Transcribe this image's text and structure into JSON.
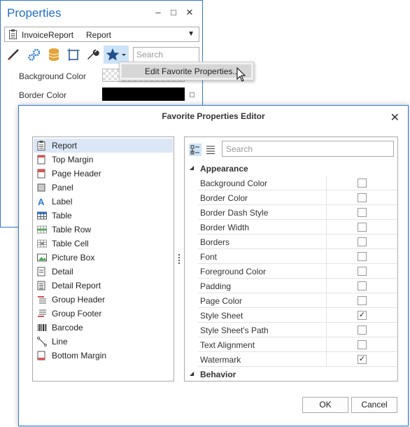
{
  "properties_panel": {
    "title": "Properties",
    "selector": {
      "name": "InvoiceReport",
      "type": "Report"
    },
    "search_placeholder": "Search",
    "rows": [
      {
        "label": "Background Color"
      },
      {
        "label": "Border Color"
      }
    ],
    "context_menu": {
      "item": "Edit Favorite Properties..."
    }
  },
  "dialog": {
    "title": "Favorite Properties Editor",
    "left_list": [
      {
        "label": "Report",
        "icon": "report-icon",
        "selected": true
      },
      {
        "label": "Top Margin",
        "icon": "top-margin-icon"
      },
      {
        "label": "Page Header",
        "icon": "page-header-icon"
      },
      {
        "label": "Panel",
        "icon": "panel-icon"
      },
      {
        "label": "Label",
        "icon": "label-icon"
      },
      {
        "label": "Table",
        "icon": "table-icon"
      },
      {
        "label": "Table Row",
        "icon": "table-row-icon"
      },
      {
        "label": "Table Cell",
        "icon": "table-cell-icon"
      },
      {
        "label": "Picture Box",
        "icon": "picture-box-icon"
      },
      {
        "label": "Detail",
        "icon": "detail-icon"
      },
      {
        "label": "Detail Report",
        "icon": "detail-report-icon"
      },
      {
        "label": "Group Header",
        "icon": "group-header-icon"
      },
      {
        "label": "Group Footer",
        "icon": "group-footer-icon"
      },
      {
        "label": "Barcode",
        "icon": "barcode-icon"
      },
      {
        "label": "Line",
        "icon": "line-icon"
      },
      {
        "label": "Bottom Margin",
        "icon": "bottom-margin-icon"
      }
    ],
    "search_placeholder": "Search",
    "categories": [
      {
        "name": "Appearance",
        "properties": [
          {
            "name": "Background Color",
            "checked": false
          },
          {
            "name": "Border Color",
            "checked": false
          },
          {
            "name": "Border Dash Style",
            "checked": false
          },
          {
            "name": "Border Width",
            "checked": false
          },
          {
            "name": "Borders",
            "checked": false
          },
          {
            "name": "Font",
            "checked": false
          },
          {
            "name": "Foreground Color",
            "checked": false
          },
          {
            "name": "Padding",
            "checked": false
          },
          {
            "name": "Page Color",
            "checked": false
          },
          {
            "name": "Style Sheet",
            "checked": true
          },
          {
            "name": "Style Sheet's Path",
            "checked": false
          },
          {
            "name": "Text Alignment",
            "checked": false
          },
          {
            "name": "Watermark",
            "checked": true
          }
        ]
      },
      {
        "name": "Behavior",
        "properties": []
      }
    ],
    "ok_label": "OK",
    "cancel_label": "Cancel"
  },
  "colors": {
    "accent": "#2b79d7",
    "title_text": "#1f6fc5",
    "selection": "#dbe7f6"
  }
}
